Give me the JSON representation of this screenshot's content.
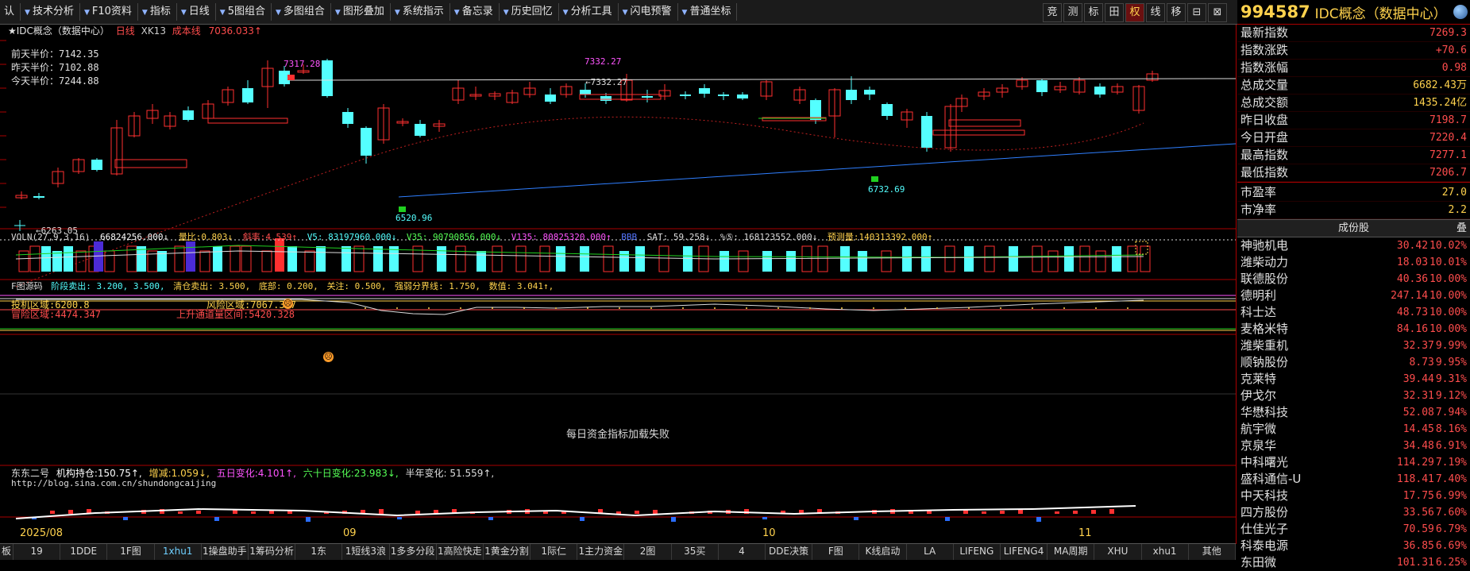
{
  "toolbar": {
    "items": [
      "认",
      "技术分析",
      "F10资料",
      "指标",
      "日线",
      "5图组合",
      "多图组合",
      "图形叠加",
      "系统指示",
      "备忘录",
      "历史回忆",
      "分析工具",
      "闪电预警",
      "普通坐标"
    ],
    "right_buttons": [
      "竞",
      "测",
      "标",
      "田",
      "权",
      "线",
      "移",
      "⊟",
      "⊠"
    ]
  },
  "chart": {
    "title": "★IDC概念（数据中心）",
    "period": "日线",
    "xk": "XK13",
    "cost_label": "成本线",
    "cost_value": "7036.033↑",
    "price_labels": {
      "high1": "7317.28",
      "high2": "7332.27",
      "high2b": "←7332.27",
      "low1": "6520.96",
      "low2": "6732.69",
      "left": "←6263.05"
    },
    "legend": {
      "qian": "前天半价：7142.35",
      "zuo": "昨天半价：7102.88",
      "jin": "今天半价：7244.88"
    }
  },
  "vol": {
    "label": "VOLN(27,9,3,16)",
    "v0": "66824256.000↓",
    "liangbi_k": "量比:",
    "liangbi_v": "0.803↓",
    "xielv_k": "斜率:",
    "xielv_v": "4.539↑",
    "v5": "V5: 83197960.000↓",
    "v35": "V35: 90790856.000↓",
    "v135": "V135: 80825320.000↑",
    "bbb": "BBB",
    "sat": "SAT: 59.258↓",
    "pct": "%⑤: 168123552.000↓",
    "yuce_k": "预测量:",
    "yuce_v": "140313392.000↑"
  },
  "ind1": {
    "name": "F图源码",
    "t1": "阶段卖出: 3.200, 3.500,",
    "t2": "清仓卖出: 3.500,",
    "t3": "底部: 0.200,",
    "t4": "关注: 0.500,",
    "t5": "强弱分界线: 1.750,",
    "t6": "数值: 3.041↑,",
    "touji": "投机区域:6200.8",
    "maoxian": "冒险区域:4474.347",
    "fengxian": "风险区域:7067.307",
    "shangsheng": "上升通道量区间:5420.328"
  },
  "ind2": {
    "fail": "每日资金指标加载失败"
  },
  "ind3": {
    "name": "东东二号",
    "jg_k": "机构持仓:",
    "jg_v": "150.75↑,",
    "zj_k": "增减:",
    "zj_v": "1.059↓,",
    "wr_k": "五日变化:",
    "wr_v": "4.101↑,",
    "lsr_k": "六十日变化:",
    "lsr_v": "23.983↓,",
    "bn": "半年变化: 51.559↑,",
    "url": "http://blog.sina.com.cn/shundongcaijing"
  },
  "axis": {
    "m1": "2025/08",
    "m2": "09",
    "m3": "10",
    "m4": "11"
  },
  "bottom_tabs": [
    "板",
    "19",
    "1DDE",
    "1F图",
    "1xhu1",
    "1操盘助手",
    "1筹码分析",
    "1东",
    "1短线3浪",
    "1多多分段",
    "1高险快走",
    "1黄金分割",
    "1际仁",
    "1主力资金",
    "2图",
    "35买",
    "4",
    "DDE决策",
    "F图",
    "K线启动",
    "LA",
    "LIFENG",
    "LIFENG4",
    "MA周期",
    "XHU",
    "xhu1",
    "其他"
  ],
  "right": {
    "code": "994587",
    "name": "IDC概念（数据中心）",
    "stats": [
      {
        "k": "最新指数",
        "v": "7269.3"
      },
      {
        "k": "指数涨跌",
        "v": "+70.6"
      },
      {
        "k": "指数涨幅",
        "v": "0.98"
      },
      {
        "k": "总成交量",
        "v": "6682.43万"
      },
      {
        "k": "总成交额",
        "v": "1435.24亿"
      },
      {
        "k": "昨日收盘",
        "v": "7198.7"
      },
      {
        "k": "今日开盘",
        "v": "7220.4"
      },
      {
        "k": "最高指数",
        "v": "7277.1"
      },
      {
        "k": "最低指数",
        "v": "7206.7"
      },
      {
        "k": "市盈率",
        "v": "27.0"
      },
      {
        "k": "市净率",
        "v": "2.2"
      }
    ],
    "section": "成份股",
    "section_right": "叠",
    "components": [
      {
        "n": "神驰机电",
        "p": "30.42",
        "c": "10.02%"
      },
      {
        "n": "潍柴动力",
        "p": "18.03",
        "c": "10.01%"
      },
      {
        "n": "联德股份",
        "p": "40.36",
        "c": "10.00%"
      },
      {
        "n": "德明利",
        "p": "247.14",
        "c": "10.00%"
      },
      {
        "n": "科士达",
        "p": "48.73",
        "c": "10.00%"
      },
      {
        "n": "麦格米特",
        "p": "84.16",
        "c": "10.00%"
      },
      {
        "n": "潍柴重机",
        "p": "32.37",
        "c": "9.99%"
      },
      {
        "n": "顺钠股份",
        "p": "8.73",
        "c": "9.95%"
      },
      {
        "n": "克莱特",
        "p": "39.44",
        "c": "9.31%"
      },
      {
        "n": "伊戈尔",
        "p": "32.31",
        "c": "9.12%"
      },
      {
        "n": "华懋科技",
        "p": "52.08",
        "c": "7.94%"
      },
      {
        "n": "航宇微",
        "p": "14.45",
        "c": "8.16%"
      },
      {
        "n": "京泉华",
        "p": "34.48",
        "c": "6.91%"
      },
      {
        "n": "中科曙光",
        "p": "114.29",
        "c": "7.19%"
      },
      {
        "n": "盛科通信-U",
        "p": "118.41",
        "c": "7.40%"
      },
      {
        "n": "中天科技",
        "p": "17.75",
        "c": "6.99%"
      },
      {
        "n": "四方股份",
        "p": "33.56",
        "c": "7.60%"
      },
      {
        "n": "仕佳光子",
        "p": "70.59",
        "c": "6.79%"
      },
      {
        "n": "科泰电源",
        "p": "36.85",
        "c": "6.69%"
      },
      {
        "n": "东田微",
        "p": "101.31",
        "c": "6.25%"
      }
    ]
  },
  "colors": {
    "up": "#ff3030",
    "down": "#54ffff",
    "accent": "#ffd24d",
    "border": "#aa0000"
  }
}
